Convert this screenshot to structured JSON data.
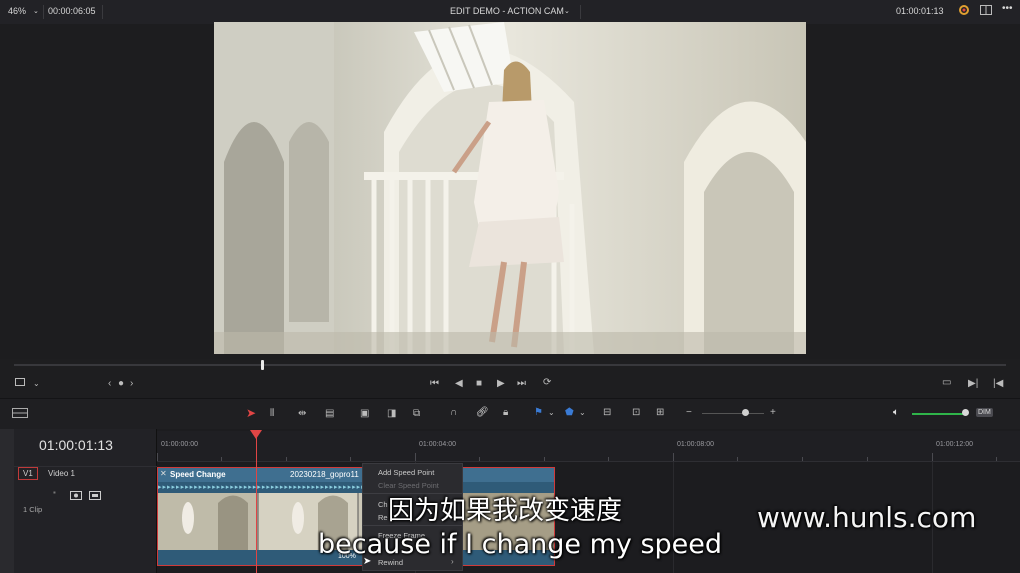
{
  "topbar": {
    "zoom": "46%",
    "source_timecode": "00:00:06:05",
    "title": "EDIT DEMO - ACTION CAM",
    "record_timecode": "01:00:01:13"
  },
  "timeline": {
    "current_timecode": "01:00:01:13",
    "ruler_labels": [
      "01:00:00:00",
      "01:00:04:00",
      "01:00:08:00",
      "01:00:12:00"
    ],
    "track_id": "V1",
    "track_name": "Video 1",
    "clip_count": "1 Clip",
    "clip": {
      "label": "Speed Change",
      "filename": "20230218_gopro11",
      "speed": "100%"
    },
    "dim_label": "DIM"
  },
  "context_menu": {
    "items": [
      {
        "label": "Add Speed Point",
        "enabled": true
      },
      {
        "label": "Clear Speed Point",
        "enabled": false
      },
      {
        "label": "Ch",
        "enabled": true
      },
      {
        "label": "Re",
        "enabled": true
      },
      {
        "label": "Freeze Frame",
        "enabled": true
      },
      {
        "label": "Rewind",
        "enabled": true
      }
    ]
  },
  "subtitles": {
    "chinese": "因为如果我改变速度",
    "english": "because if I change my speed",
    "watermark": "www.hunls.com"
  },
  "colors": {
    "accent_red": "#e04545",
    "clip_blue": "#3f6f90",
    "volume_green": "#2fb44a"
  }
}
